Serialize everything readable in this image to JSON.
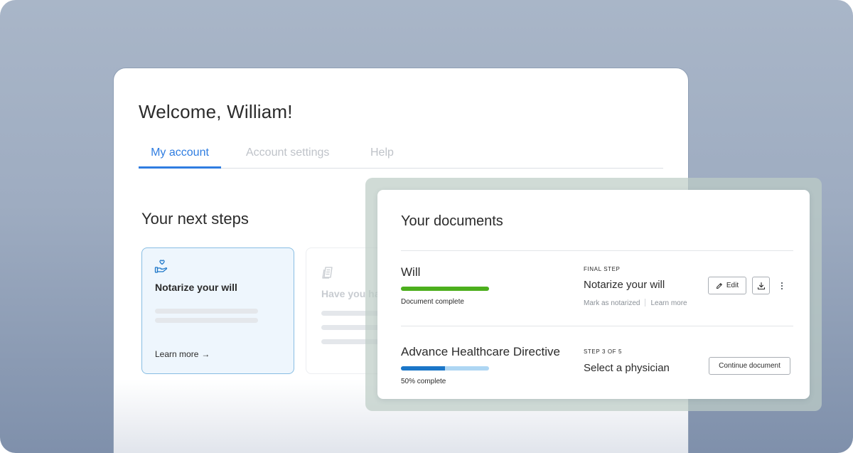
{
  "header": {
    "welcome": "Welcome, William!"
  },
  "tabs": [
    {
      "label": "My account",
      "active": true
    },
    {
      "label": "Account settings",
      "active": false
    },
    {
      "label": "Help",
      "active": false
    }
  ],
  "next_steps": {
    "title": "Your next steps",
    "cards": [
      {
        "title": "Notarize your will",
        "link": "Learn more",
        "icon": "hand-heart-icon",
        "active": true
      },
      {
        "title": "Have you ha",
        "icon": "document-stack-icon",
        "active": false
      }
    ]
  },
  "documents": {
    "title": "Your documents",
    "items": [
      {
        "name": "Will",
        "progress": 1.0,
        "status": "Document complete",
        "step_label": "FINAL STEP",
        "step_name": "Notarize your will",
        "links": [
          "Mark as notarized",
          "Learn more"
        ],
        "edit_label": "Edit",
        "bar_color": "#4caf1d"
      },
      {
        "name": "Advance Healthcare Directive",
        "progress": 0.5,
        "status": "50% complete",
        "step_label": "STEP 3 OF 5",
        "step_name": "Select a physician",
        "continue_label": "Continue document",
        "bar_color": "#1b76c8",
        "bar_track_color": "#aed6f3"
      }
    ]
  },
  "colors": {
    "accent": "#2f7de1",
    "active_card_bg": "#eef6fd",
    "active_card_border": "#88bde3"
  }
}
